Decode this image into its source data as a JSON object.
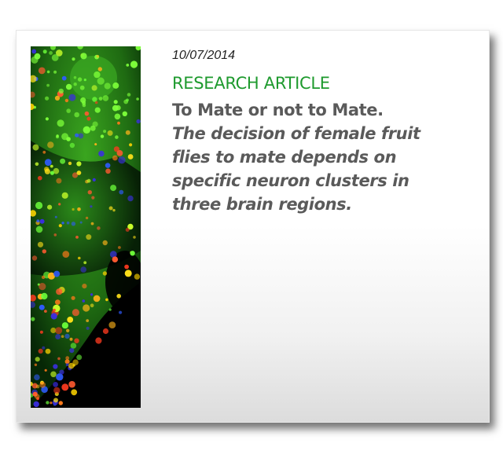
{
  "article": {
    "date": "10/07/2014",
    "category": "RESEARCH ARTICLE",
    "title": "To Mate or not to Mate.",
    "subtitle": "The decision of female fruit flies to mate depends on specific neuron clusters in three brain regions.",
    "thumbnail_icon": "fluorescent-neuron-image",
    "colors": {
      "category": "#1e9a2e",
      "title": "#5a5a5a"
    }
  }
}
